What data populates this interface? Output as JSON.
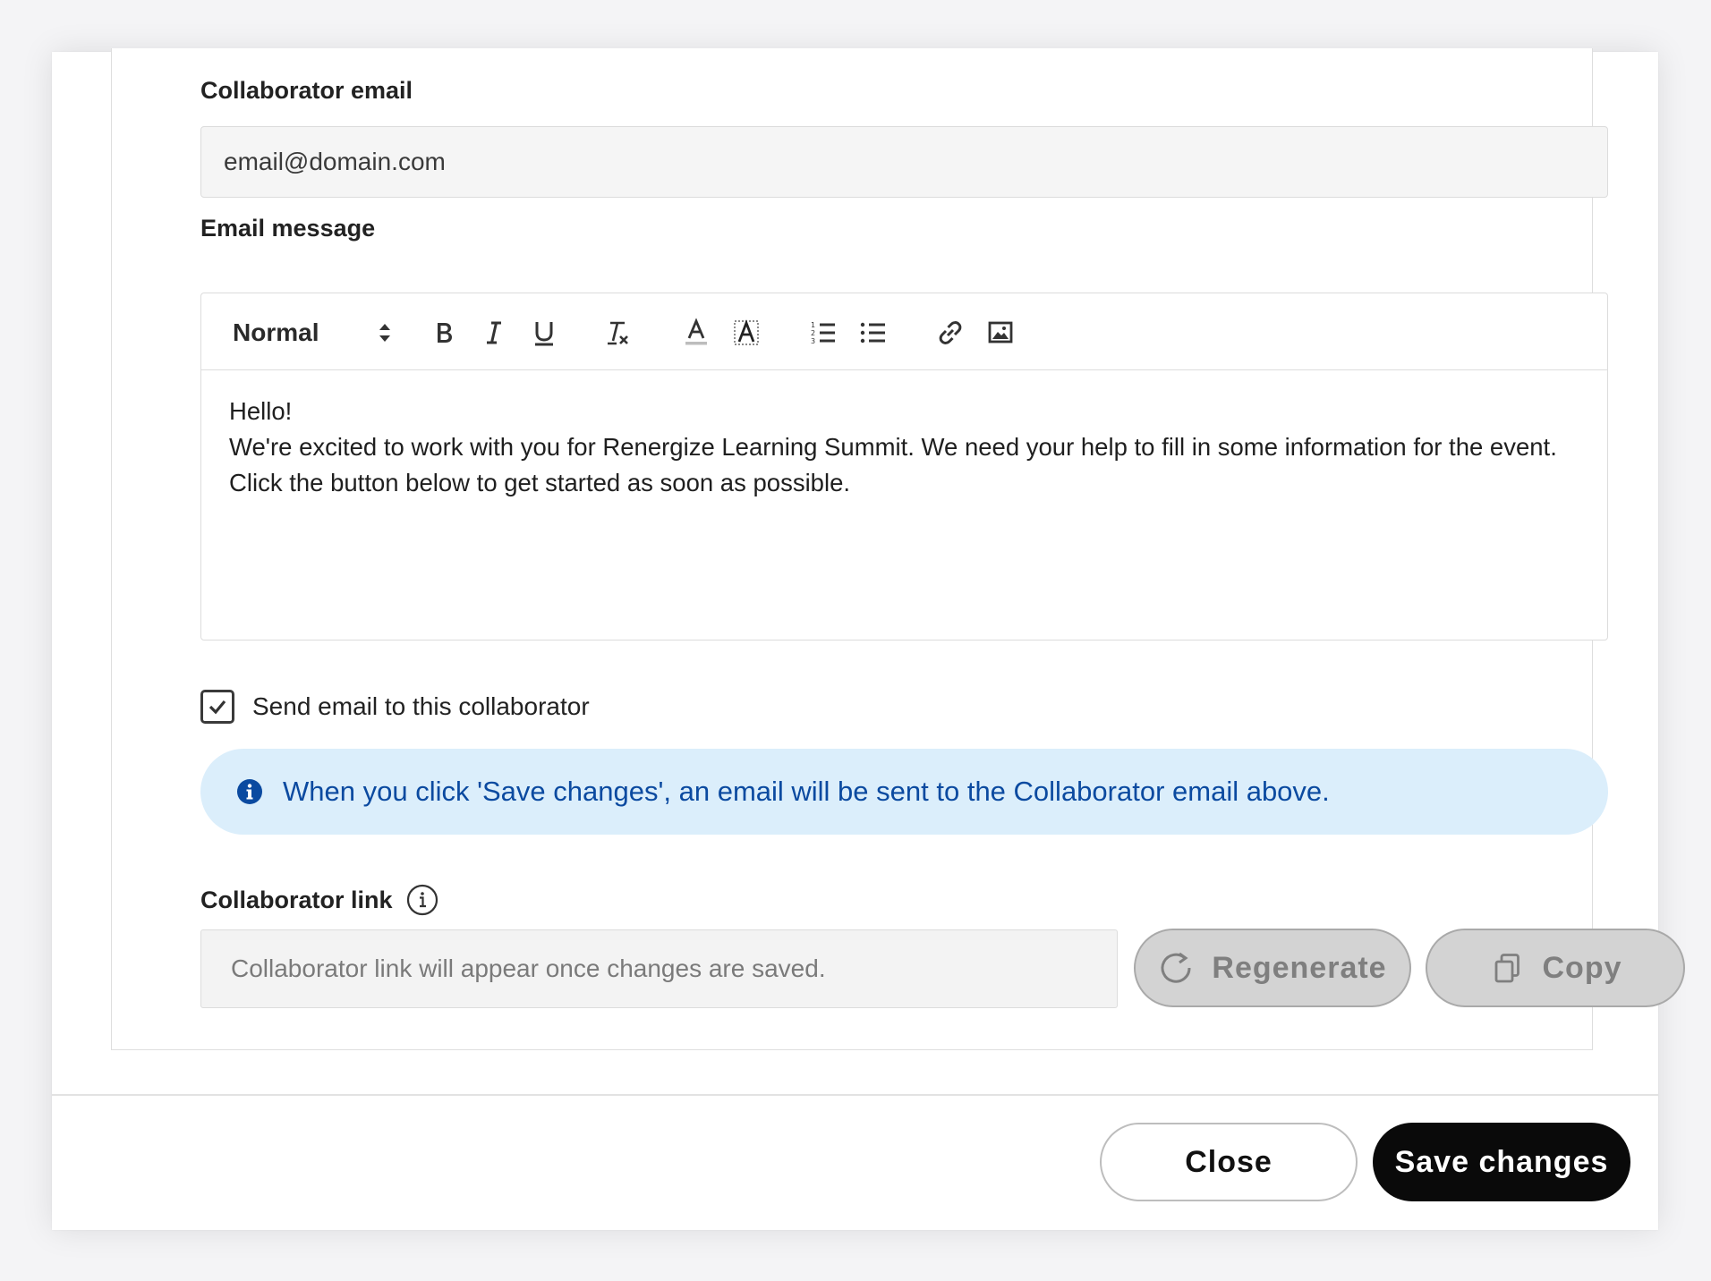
{
  "form": {
    "collaborator_email": {
      "label": "Collaborator email",
      "value": "email@domain.com"
    },
    "email_message": {
      "label": "Email message",
      "toolbar": {
        "format_value": "Normal",
        "buttons": [
          "bold-icon",
          "italic-icon",
          "underline-icon",
          "clear-format-icon",
          "font-color-icon",
          "highlight-icon",
          "ordered-list-icon",
          "bullet-list-icon",
          "link-icon",
          "image-icon"
        ]
      },
      "lines": [
        "Hello!",
        "We're excited to work with you for Renergize Learning Summit. We need your help to fill in some information for the event.",
        "Click the button below to get started as soon as possible."
      ]
    },
    "send_email": {
      "label": "Send email to this collaborator",
      "checked": true
    },
    "info_banner": {
      "text": "When you click 'Save changes', an email will be sent to the Collaborator email above.",
      "color": "#0b4aa0",
      "background": "#dbeefb"
    },
    "collaborator_link": {
      "label": "Collaborator link",
      "placeholder": "Collaborator link will appear once changes are saved.",
      "regenerate_label": "Regenerate",
      "copy_label": "Copy"
    }
  },
  "footer": {
    "close_label": "Close",
    "save_label": "Save changes"
  }
}
